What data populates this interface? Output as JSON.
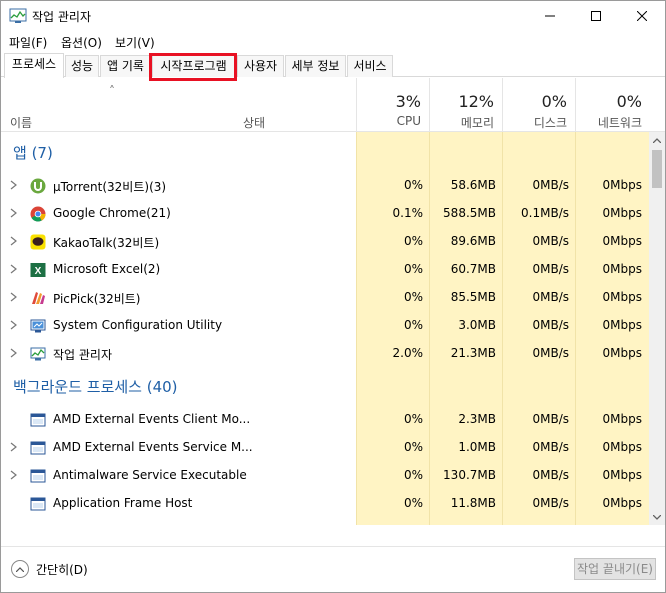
{
  "window": {
    "title": "작업 관리자"
  },
  "menu": [
    "파일(F)",
    "옵션(O)",
    "보기(V)"
  ],
  "tabs": [
    "프로세스",
    "성능",
    "앱 기록",
    "시작프로그램",
    "사용자",
    "세부 정보",
    "서비스"
  ],
  "header": {
    "name": "이름",
    "status": "상태",
    "columns": [
      {
        "pct": "3%",
        "label": "CPU"
      },
      {
        "pct": "12%",
        "label": "메모리"
      },
      {
        "pct": "0%",
        "label": "디스크"
      },
      {
        "pct": "0%",
        "label": "네트워크"
      }
    ]
  },
  "groups": {
    "apps": "앱 (7)",
    "background": "백그라운드 프로세스 (40)"
  },
  "apps": [
    {
      "name": "µTorrent(32비트)(3)",
      "icon": "utorrent-icon",
      "cpu": "0%",
      "mem": "58.6MB",
      "disk": "0MB/s",
      "net": "0Mbps"
    },
    {
      "name": "Google Chrome(21)",
      "icon": "chrome-icon",
      "cpu": "0.1%",
      "mem": "588.5MB",
      "disk": "0.1MB/s",
      "net": "0Mbps"
    },
    {
      "name": "KakaoTalk(32비트)",
      "icon": "kakaotalk-icon",
      "cpu": "0%",
      "mem": "89.6MB",
      "disk": "0MB/s",
      "net": "0Mbps"
    },
    {
      "name": "Microsoft Excel(2)",
      "icon": "excel-icon",
      "cpu": "0%",
      "mem": "60.7MB",
      "disk": "0MB/s",
      "net": "0Mbps"
    },
    {
      "name": "PicPick(32비트)",
      "icon": "picpick-icon",
      "cpu": "0%",
      "mem": "85.5MB",
      "disk": "0MB/s",
      "net": "0Mbps"
    },
    {
      "name": "System Configuration Utility",
      "icon": "msconfig-icon",
      "cpu": "0%",
      "mem": "3.0MB",
      "disk": "0MB/s",
      "net": "0Mbps"
    },
    {
      "name": "작업 관리자",
      "icon": "task-manager-icon",
      "cpu": "2.0%",
      "mem": "21.3MB",
      "disk": "0MB/s",
      "net": "0Mbps"
    }
  ],
  "background": [
    {
      "name": "AMD External Events Client Mo...",
      "icon": "service-icon",
      "cpu": "0%",
      "mem": "2.3MB",
      "disk": "0MB/s",
      "net": "0Mbps"
    },
    {
      "name": "AMD External Events Service M...",
      "icon": "service-icon",
      "cpu": "0%",
      "mem": "1.0MB",
      "disk": "0MB/s",
      "net": "0Mbps"
    },
    {
      "name": "Antimalware Service Executable",
      "icon": "service-icon",
      "cpu": "0%",
      "mem": "130.7MB",
      "disk": "0MB/s",
      "net": "0Mbps"
    },
    {
      "name": "Application Frame Host",
      "icon": "service-icon",
      "cpu": "0%",
      "mem": "11.8MB",
      "disk": "0MB/s",
      "net": "0Mbps"
    }
  ],
  "footer": {
    "collapse": "간단히(D)",
    "end_task": "작업 끝내기(E)"
  },
  "colors": {
    "accent_group": "#1f5fa6",
    "heat_bg": "#fff4c4",
    "highlight_box": "#e81123"
  }
}
